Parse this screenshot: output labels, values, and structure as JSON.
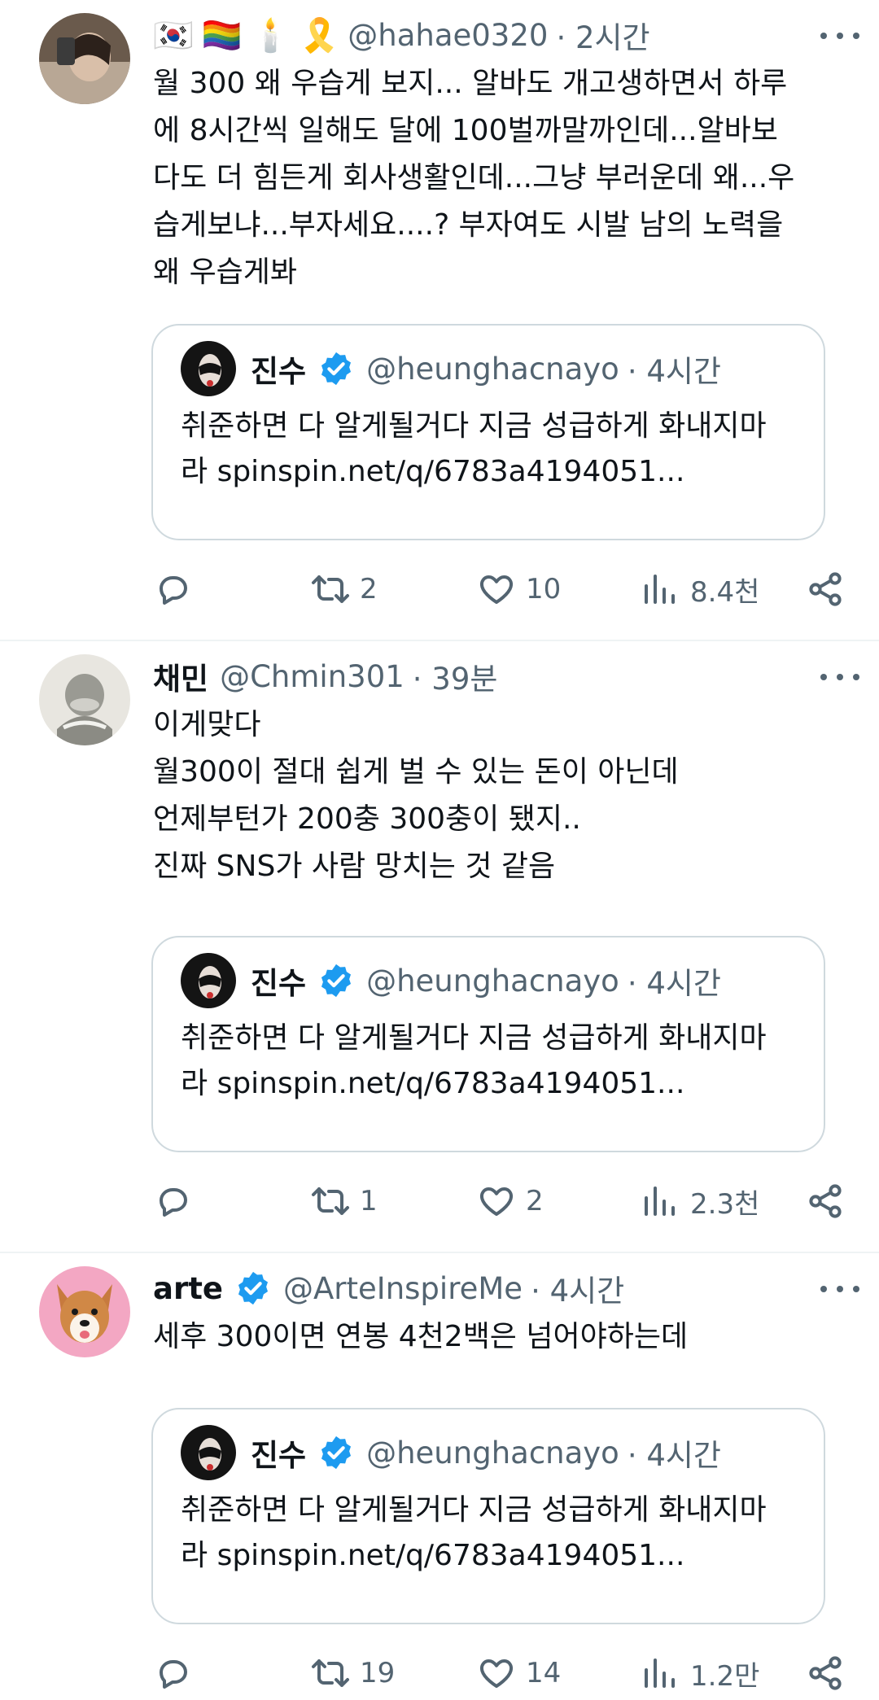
{
  "tweets": [
    {
      "name": "",
      "badges": [
        "🇰🇷",
        "🏳️‍🌈",
        "🕯️",
        "🎗️"
      ],
      "handle": "@hahae0320",
      "time": "· 2시간",
      "text": "월 300 왜 우습게 보지... 알바도 개고생하면서 하루\n에 8시간씩 일해도 달에 100벌까말까인데...알바보\n다도 더 힘든게 회사생활인데...그냥 부러운데 왜...우\n습게보냐...부자세요....? 부자여도 시발 남의 노력을\n왜 우습게봐",
      "verified": false,
      "quote": {
        "name": "진수",
        "handle": "@heunghacnayo",
        "time": "· 4시간",
        "text": "취준하면 다 알게될거다 지금 성급하게 화내지마\n라 spinspin.net/q/6783a4194051..."
      },
      "stats": {
        "replies": "",
        "retweets": "2",
        "likes": "10",
        "views": "8.4천"
      }
    },
    {
      "name": "채민",
      "badges": [],
      "handle": "@Chmin301",
      "time": "· 39분",
      "text": "이게맞다\n월300이 절대 쉽게 벌 수 있는 돈이 아닌데\n언제부턴가 200충 300충이 됐지..\n진짜 SNS가 사람 망치는 것 같음",
      "verified": false,
      "quote": {
        "name": "진수",
        "handle": "@heunghacnayo",
        "time": "· 4시간",
        "text": "취준하면 다 알게될거다 지금 성급하게 화내지마\n라 spinspin.net/q/6783a4194051..."
      },
      "stats": {
        "replies": "",
        "retweets": "1",
        "likes": "2",
        "views": "2.3천"
      }
    },
    {
      "name": "arte",
      "badges": [],
      "handle": "@ArteInspireMe",
      "time": "· 4시간",
      "text": "세후 300이면 연봉 4천2백은 넘어야하는데",
      "verified": true,
      "quote": {
        "name": "진수",
        "handle": "@heunghacnayo",
        "time": "· 4시간",
        "text": "취준하면 다 알게될거다 지금 성급하게 화내지마\n라 spinspin.net/q/6783a4194051..."
      },
      "stats": {
        "replies": "",
        "retweets": "19",
        "likes": "14",
        "views": "1.2만"
      }
    }
  ],
  "colors": {
    "text": "#0f1419",
    "secondary": "#536471",
    "border": "#cfd9de",
    "verified": "#1d9bf0"
  }
}
